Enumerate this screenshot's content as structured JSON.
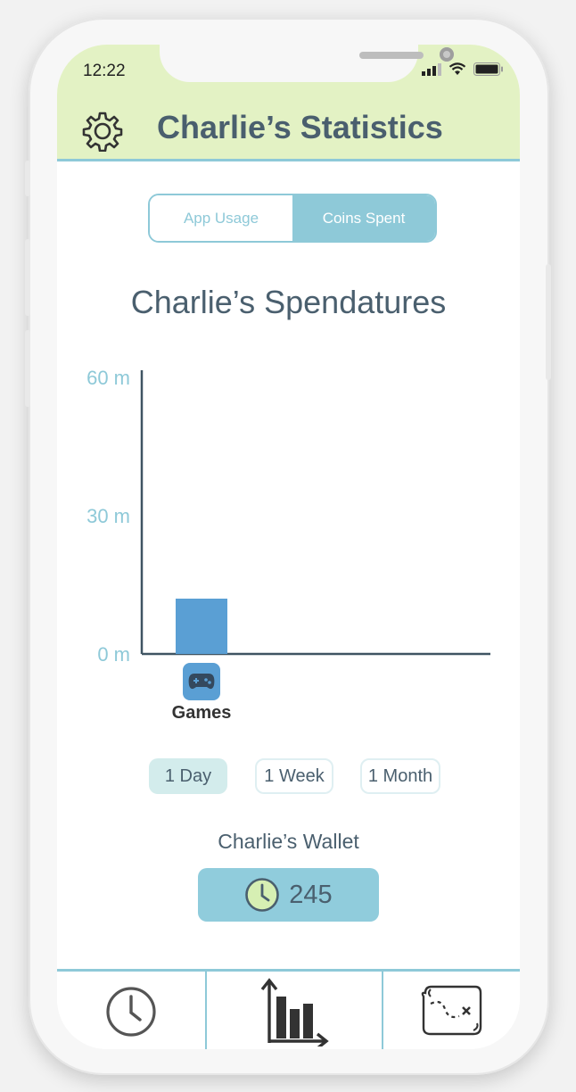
{
  "status_bar": {
    "time": "12:22"
  },
  "header": {
    "title": "Charlie’s Statistics",
    "settings_icon": "gear-icon"
  },
  "segmented": {
    "options": [
      "App Usage",
      "Coins Spent"
    ],
    "selected": "Coins Spent"
  },
  "chart_data": {
    "type": "bar",
    "title": "Charlie’s Spendatures",
    "categories": [
      "Games"
    ],
    "values": [
      12
    ],
    "y_ticks": [
      "60 m",
      "30 m",
      "0 m"
    ],
    "ylim": [
      0,
      60
    ],
    "category_icons": [
      "gamepad-icon"
    ],
    "bar_color": "#5a9fd4"
  },
  "range": {
    "options": [
      "1 Day",
      "1 Week",
      "1 Month"
    ],
    "selected": "1 Day"
  },
  "wallet": {
    "label": "Charlie’s Wallet",
    "value": "245",
    "icon": "clock-coin-icon"
  },
  "tabbar": {
    "items": [
      "clock-icon",
      "chart-icon",
      "treasure-map-icon"
    ]
  },
  "colors": {
    "header_bg": "#e3f2c4",
    "accent": "#8ec9d8",
    "text": "#4a5f6e"
  }
}
